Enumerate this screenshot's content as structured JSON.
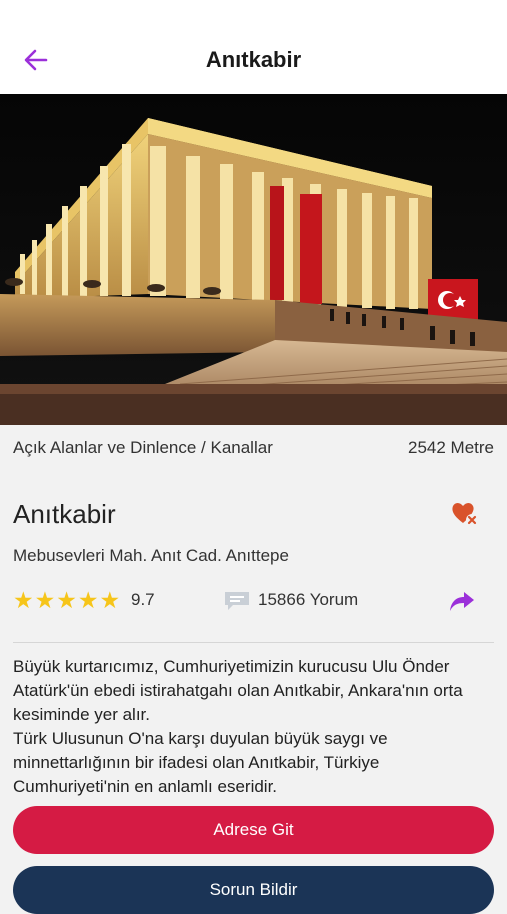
{
  "header": {
    "title": "Anıtkabir",
    "back_icon": "arrow-left-icon",
    "accent_color": "#9b30d9"
  },
  "hero": {
    "description_icon": "photo-anitkabir"
  },
  "place": {
    "category": "Açık Alanlar ve Dinlence / Kanallar",
    "distance": "2542 Metre",
    "name": "Anıtkabir",
    "favorite_icon": "heart-remove-icon",
    "address": "Mebusevleri Mah. Anıt Cad. Anıttepe",
    "rating_stars": 5,
    "rating_value": "9.7",
    "comment_count": "15866 Yorum",
    "description": "Büyük kurtarıcımız, Cumhuriyetimizin kurucusu Ulu Önder Atatürk'ün ebedi istirahatgahı olan Anıtkabir, Ankara'nın orta kesiminde yer alır.\nTürk Ulusunun O'na karşı duyulan büyük saygı ve minnettarlığının bir ifadesi olan Anıtkabir, Türkiye Cumhuriyeti'nin en anlamlı eseridir."
  },
  "actions": {
    "go_to_address": "Adrese Git",
    "report_problem": "Sorun Bildir"
  },
  "colors": {
    "primary_button": "#d51b44",
    "secondary_button": "#1b3456",
    "star": "#f6c51a",
    "favorite": "#d9532b"
  }
}
